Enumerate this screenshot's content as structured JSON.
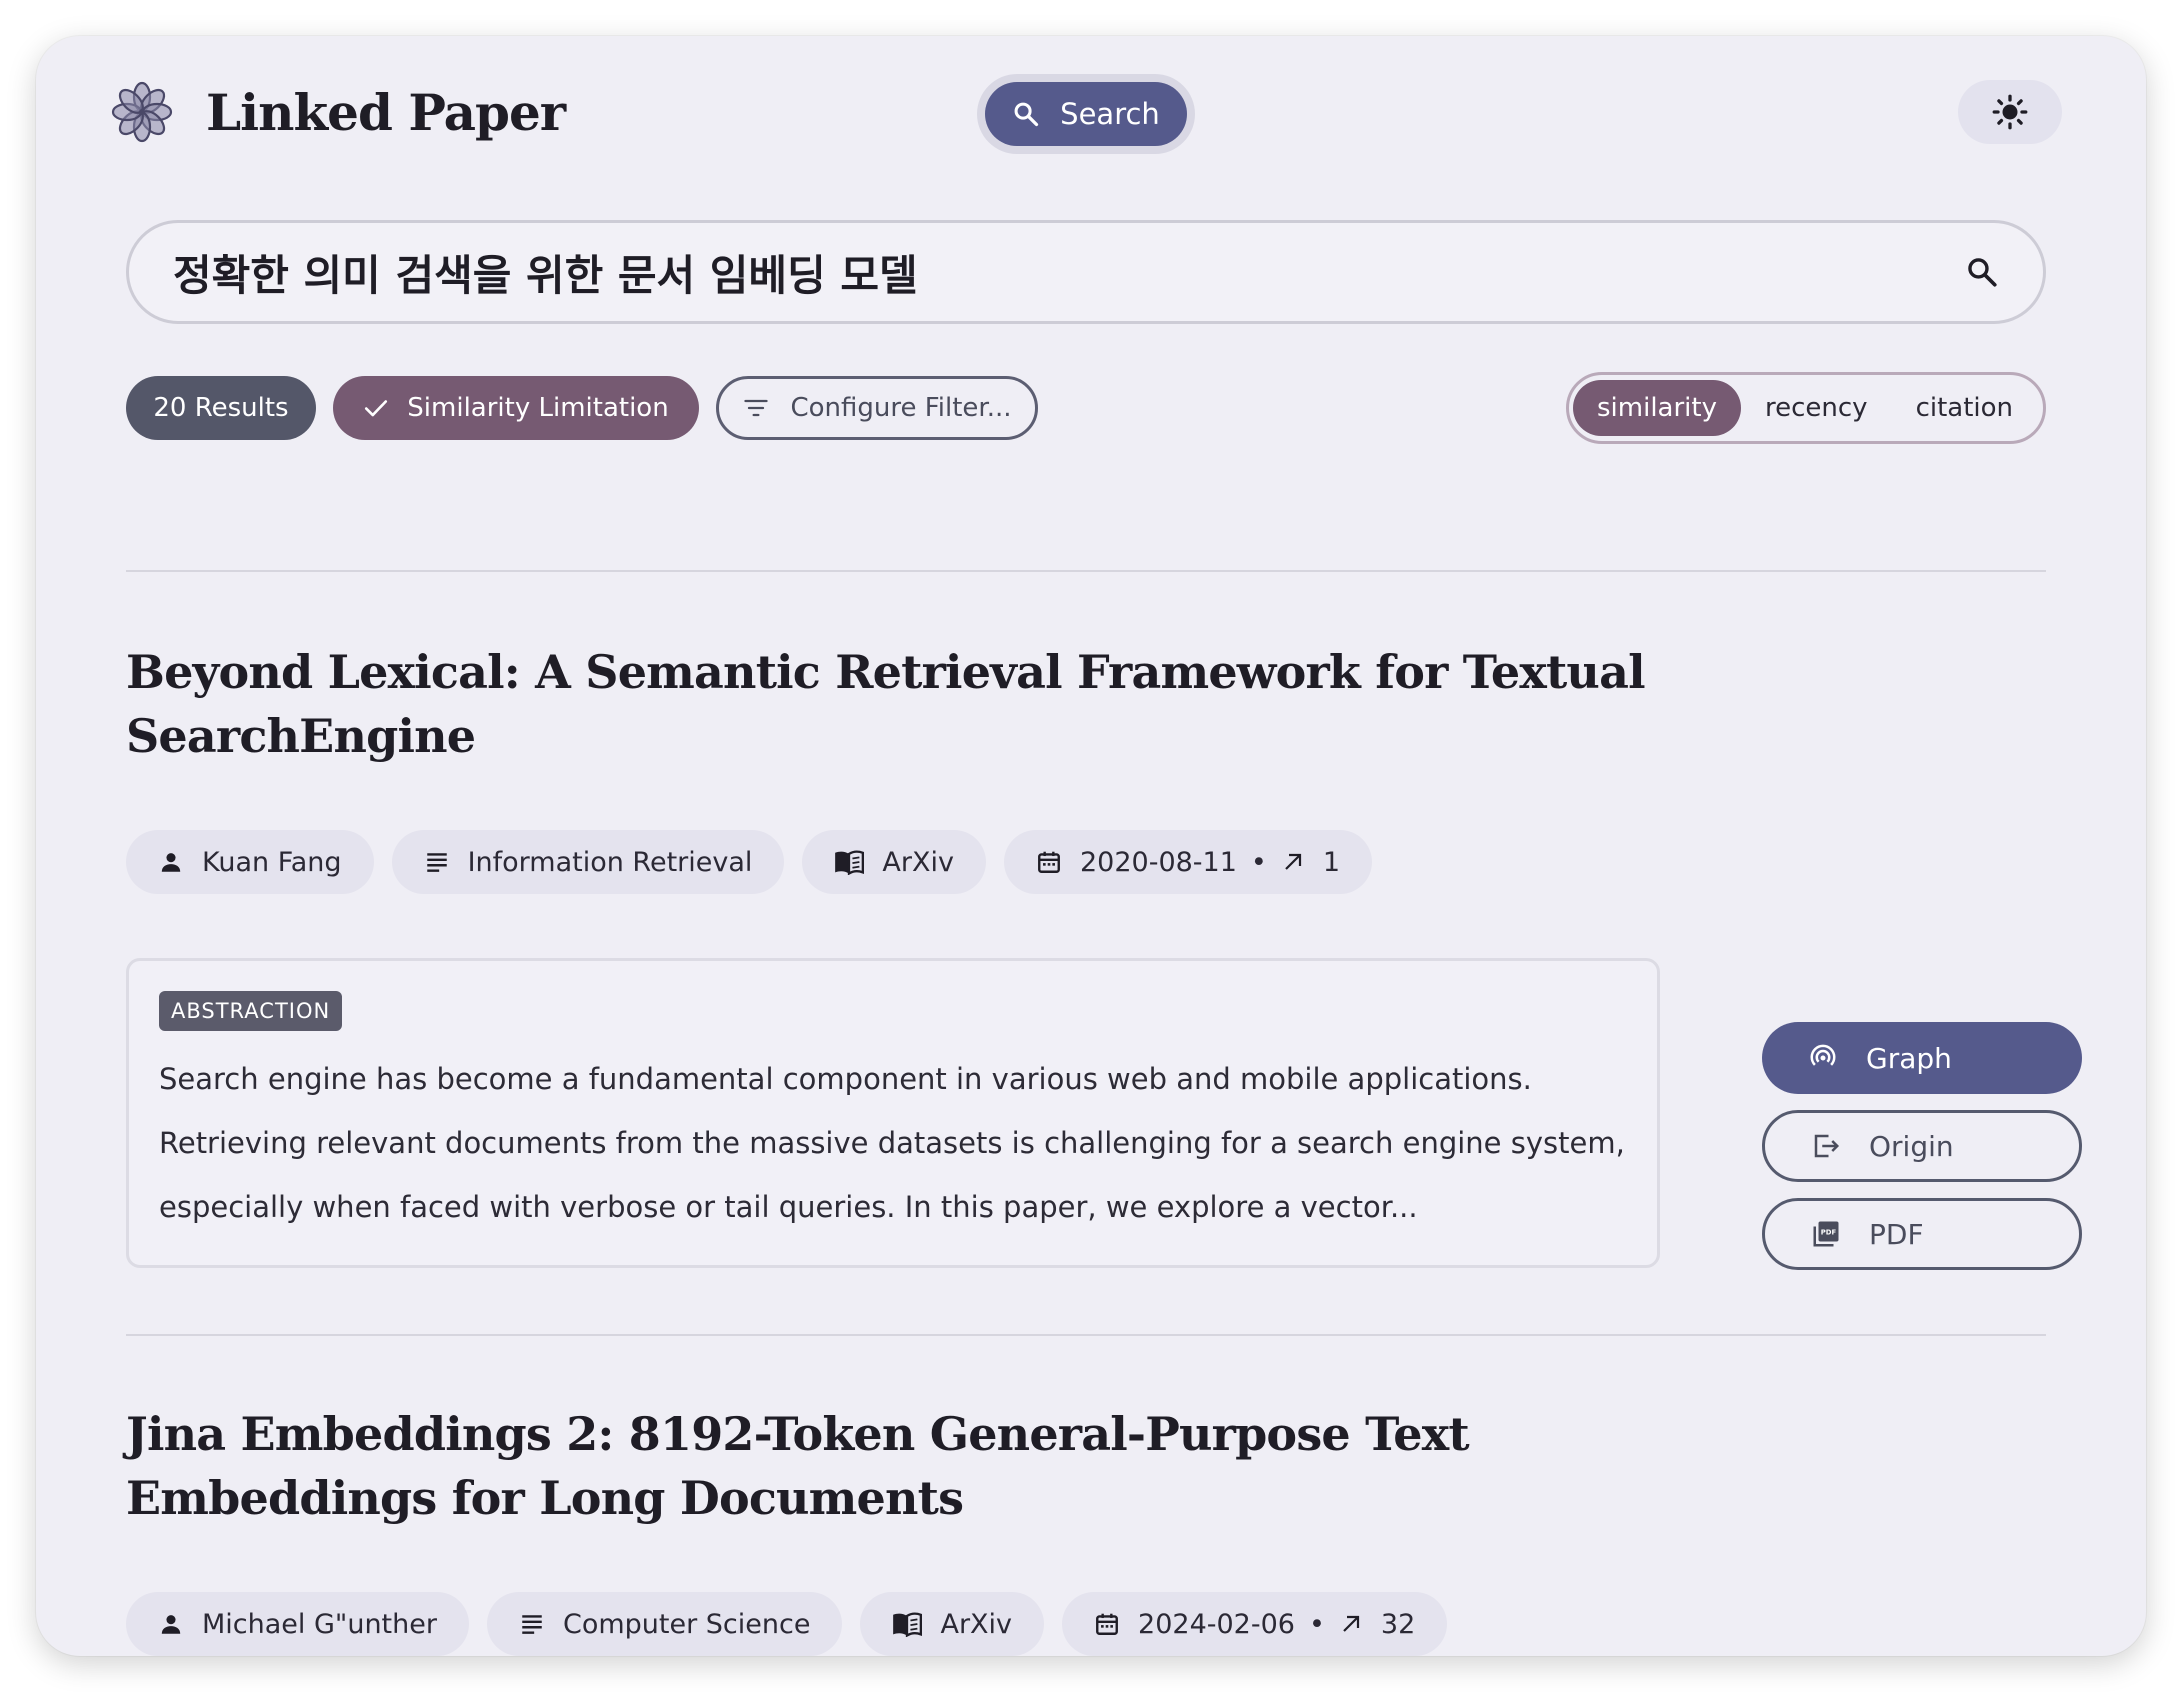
{
  "header": {
    "app_title": "Linked Paper",
    "search_button": "Search",
    "theme_icon": "sun-icon"
  },
  "search": {
    "query": "정확한 의미 검색을 위한 문서 임베딩 모델"
  },
  "filters": {
    "results_count": "20 Results",
    "similarity_limitation": "Similarity Limitation",
    "configure_filter": "Configure Filter..."
  },
  "sort": {
    "options": [
      "similarity",
      "recency",
      "citation"
    ],
    "selected": "similarity"
  },
  "papers": [
    {
      "title": "Beyond Lexical: A Semantic Retrieval Framework for Textual SearchEngine",
      "author": "Kuan Fang",
      "field": "Information Retrieval",
      "source": "ArXiv",
      "date": "2020-08-11",
      "citations": "1",
      "abstract_label": "ABSTRACTION",
      "abstract": "Search engine has become a fundamental component in various web and mobile applications. Retrieving relevant documents from the massive datasets is challenging for a search engine system, especially when faced with verbose or tail queries. In this paper, we explore a vector...",
      "actions": {
        "graph": "Graph",
        "origin": "Origin",
        "pdf": "PDF"
      }
    },
    {
      "title": "Jina Embeddings 2: 8192-Token General-Purpose Text Embeddings for Long Documents",
      "author": "Michael G\"unther",
      "field": "Computer Science",
      "source": "ArXiv",
      "date": "2024-02-06",
      "citations": "32"
    }
  ],
  "colors": {
    "accent": "#555a8c",
    "selected": "#765a72",
    "results_chip": "#545769",
    "background": "#efeef5"
  }
}
